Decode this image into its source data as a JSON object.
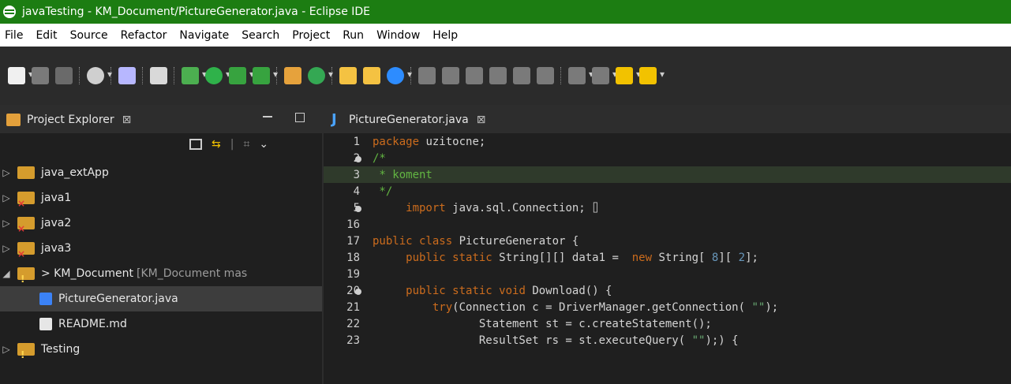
{
  "window": {
    "title": "javaTesting - KM_Document/PictureGenerator.java - Eclipse IDE"
  },
  "menu": {
    "items": [
      "File",
      "Edit",
      "Source",
      "Refactor",
      "Navigate",
      "Search",
      "Project",
      "Run",
      "Window",
      "Help"
    ]
  },
  "project_explorer": {
    "tab_label": "Project Explorer",
    "tab_close": "⊠",
    "items": [
      {
        "name": "java_extApp",
        "expanded": false
      },
      {
        "name": "java1",
        "expanded": false
      },
      {
        "name": "java2",
        "expanded": false
      },
      {
        "name": "java3",
        "expanded": false
      },
      {
        "name": "> KM_Document",
        "suffix": "[KM_Document mas",
        "expanded": true
      },
      {
        "name": "PictureGenerator.java"
      },
      {
        "name": "README.md"
      },
      {
        "name": "Testing",
        "expanded": false
      }
    ]
  },
  "editor": {
    "tab_label": "PictureGenerator.java",
    "tab_close": "⊠",
    "lines": [
      {
        "n": "1",
        "fold": false,
        "parts": [
          [
            "kw",
            "package"
          ],
          [
            "",
            "uzitocne;"
          ]
        ]
      },
      {
        "n": "2",
        "fold": true,
        "parts": [
          [
            "cm",
            "/*"
          ]
        ]
      },
      {
        "n": "3",
        "fold": false,
        "parts": [
          [
            "cm",
            " * koment"
          ]
        ],
        "highlight": true
      },
      {
        "n": "4",
        "fold": false,
        "parts": [
          [
            "cm",
            " */"
          ]
        ]
      },
      {
        "n": "5",
        "fold": true,
        "parts": [
          [
            "",
            "    "
          ],
          [
            "kw",
            "import"
          ],
          [
            "",
            "java.sql.Connection;"
          ],
          [
            "",
            "⌷"
          ]
        ]
      },
      {
        "n": "16",
        "fold": false,
        "parts": []
      },
      {
        "n": "17",
        "fold": false,
        "parts": [
          [
            "kw",
            "public"
          ],
          [
            "kw",
            "class"
          ],
          [
            "",
            "PictureGenerator {"
          ]
        ]
      },
      {
        "n": "18",
        "fold": false,
        "parts": [
          [
            "",
            "    "
          ],
          [
            "kw",
            "public"
          ],
          [
            "kw",
            "static"
          ],
          [
            "",
            "String[][] data1 = "
          ],
          [
            "kw",
            "new"
          ],
          [
            "",
            "String["
          ],
          [
            "num",
            "8"
          ],
          [
            "",
            "]["
          ],
          [
            "num",
            "2"
          ],
          [
            "",
            "];"
          ]
        ]
      },
      {
        "n": "19",
        "fold": false,
        "parts": []
      },
      {
        "n": "20",
        "fold": true,
        "parts": [
          [
            "",
            "    "
          ],
          [
            "kw",
            "public"
          ],
          [
            "kw",
            "static"
          ],
          [
            "kw",
            "void"
          ],
          [
            "",
            "Download() {"
          ]
        ]
      },
      {
        "n": "21",
        "fold": false,
        "parts": [
          [
            "",
            "        "
          ],
          [
            "kw",
            "try"
          ],
          [
            "",
            "(Connection c = DriverManager.getConnection("
          ],
          [
            "str",
            "\"\""
          ],
          [
            "",
            ");"
          ]
        ]
      },
      {
        "n": "22",
        "fold": false,
        "parts": [
          [
            "",
            "                Statement st = c.createStatement();"
          ]
        ]
      },
      {
        "n": "23",
        "fold": false,
        "parts": [
          [
            "",
            "                ResultSet rs = st.executeQuery("
          ],
          [
            "str",
            "\"\""
          ],
          [
            "",
            ");) {"
          ]
        ]
      }
    ]
  }
}
